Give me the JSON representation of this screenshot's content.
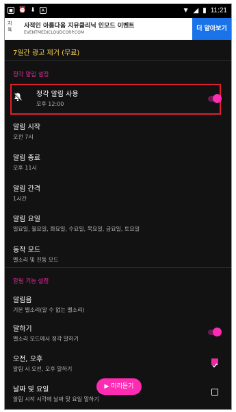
{
  "status_bar": {
    "left_icons": [
      "cam-icon",
      "alarm-icon",
      "download-icon",
      "a-icon"
    ],
    "right_icons": [
      "wifi-icon",
      "signal-icon",
      "battery-icon"
    ],
    "time": "11:21"
  },
  "ad": {
    "left_text_1": "지",
    "left_text_2": "육",
    "title": "사적인 아름다움 지유클리닉 인모드 이벤트",
    "url": "EVENTMEDICLOUDCORP.COM",
    "cta": "더 알아보기"
  },
  "promo": {
    "remove_ads": "7일간 광고 제거 (무료)"
  },
  "sections": {
    "hourly": "정각 알림 설정",
    "features": "알림 기능 설정"
  },
  "items": {
    "hourly_use": {
      "title": "정각 알림 사용",
      "subtitle": "오후 12:00"
    },
    "start": {
      "title": "알림 시작",
      "subtitle": "오전 7시"
    },
    "end": {
      "title": "알림 종료",
      "subtitle": "오후 11시"
    },
    "interval": {
      "title": "알림 간격",
      "subtitle": "1시간"
    },
    "days": {
      "title": "알림 요일",
      "subtitle": "일요일, 월요일, 화요일, 수요일, 목요일, 금요일, 토요일"
    },
    "mode": {
      "title": "동작 모드",
      "subtitle": "벨소리 및 진동 모드"
    },
    "sound": {
      "title": "알림음",
      "subtitle": "기본 벨소리(알 수 없는 벨소리)"
    },
    "speak": {
      "title": "말하기",
      "subtitle": "벨소리 모드에서 정각 말하기"
    },
    "ampm": {
      "title": "오전, 오후",
      "subtitle": "알림 시 오전, 오후 말하기"
    },
    "date_day": {
      "title": "날짜 및 요일",
      "subtitle": "알림 시작 시각에 날짜 및 요일 말하기"
    }
  },
  "controls": {
    "hourly_use_enabled": true,
    "speak_enabled": true,
    "ampm_checked": true,
    "date_day_checked": false
  },
  "fab": {
    "label": "미리듣기",
    "icon": "play-icon"
  },
  "colors": {
    "accent": "#ea2ca0",
    "promo": "#ffd54f",
    "highlight_border": "#e0202e",
    "background": "#121212"
  }
}
